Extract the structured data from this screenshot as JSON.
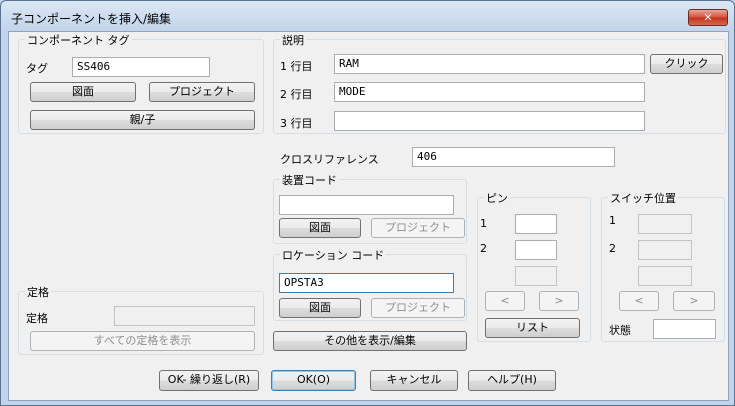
{
  "window": {
    "title": "子コンポーネントを挿入/編集",
    "close_glyph": "✕"
  },
  "component_tag": {
    "group_label": "コンポーネント タグ",
    "tag_label": "タグ",
    "tag_value": "SS406",
    "drawing_button": "図面",
    "project_button": "プロジェクト",
    "parent_child_button": "親/子"
  },
  "description": {
    "group_label": "説明",
    "line1_label": "1 行目",
    "line1_value": "RAM",
    "line2_label": "2 行目",
    "line2_value": "MODE",
    "line3_label": "3 行目",
    "line3_value": "",
    "click_button": "クリック"
  },
  "cross_reference": {
    "label": "クロスリファレンス",
    "value": "406"
  },
  "device_code": {
    "group_label": "装置コード",
    "value": "",
    "drawing_button": "図面",
    "project_button": "プロジェクト"
  },
  "location_code": {
    "group_label": "ロケーション コード",
    "value": "OPSTA3",
    "drawing_button": "図面",
    "project_button": "プロジェクト"
  },
  "show_edit_button": "その他を表示/編集",
  "pins": {
    "group_label": "ピン",
    "pin1_label": "1",
    "pin1_value": "",
    "pin2_label": "2",
    "pin2_value": "",
    "prev_glyph": "<",
    "next_glyph": ">",
    "list_button": "リスト"
  },
  "switch_position": {
    "group_label": "スイッチ位置",
    "pos1_label": "1",
    "pos2_label": "2",
    "prev_glyph": "<",
    "next_glyph": ">",
    "state_label": "状態",
    "state_value": ""
  },
  "rating": {
    "group_label": "定格",
    "rating_label": "定格",
    "rating_value": "",
    "show_all_button": "すべての定格を表示"
  },
  "footer": {
    "ok_repeat_button": "OK- 繰り返し(R)",
    "ok_button": "OK(O)",
    "cancel_button": "キャンセル",
    "help_button": "ヘルプ(H)"
  }
}
